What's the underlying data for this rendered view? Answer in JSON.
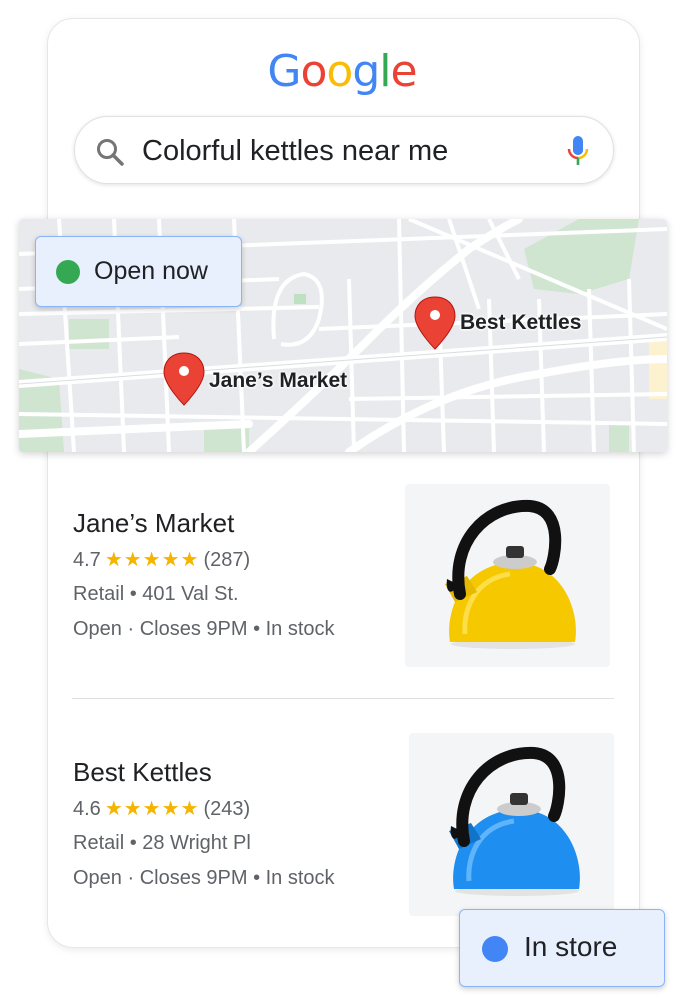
{
  "logo": {
    "letters": [
      "G",
      "o",
      "o",
      "g",
      "l",
      "e"
    ]
  },
  "search": {
    "query": "Colorful kettles near me"
  },
  "colors": {
    "blue": "#4285f4",
    "red": "#ea4335",
    "yellow": "#fbbc05",
    "green": "#34a853",
    "star": "#f4b400"
  },
  "map": {
    "filter_chip": {
      "label": "Open now",
      "dot_color": "#34a853"
    },
    "pins": [
      {
        "label": "Best Kettles",
        "icon": "map-pin-icon"
      },
      {
        "label": "Jane’s Market",
        "icon": "map-pin-icon"
      }
    ]
  },
  "results": [
    {
      "name": "Jane’s Market",
      "rating": "4.7",
      "stars": "★★★★★",
      "reviews": "(287)",
      "category": "Retail • 401 Val St.",
      "status": "Open · Closes 9PM • In stock",
      "product_color": "#f5c800"
    },
    {
      "name": "Best Kettles",
      "rating": "4.6",
      "stars": "★★★★★",
      "reviews": "(243)",
      "category": "Retail • 28 Wright Pl",
      "status": "Open · Closes 9PM • In stock",
      "product_color": "#1e8ef0"
    }
  ],
  "in_store_chip": {
    "label": "In store",
    "dot_color": "#4285f4"
  }
}
